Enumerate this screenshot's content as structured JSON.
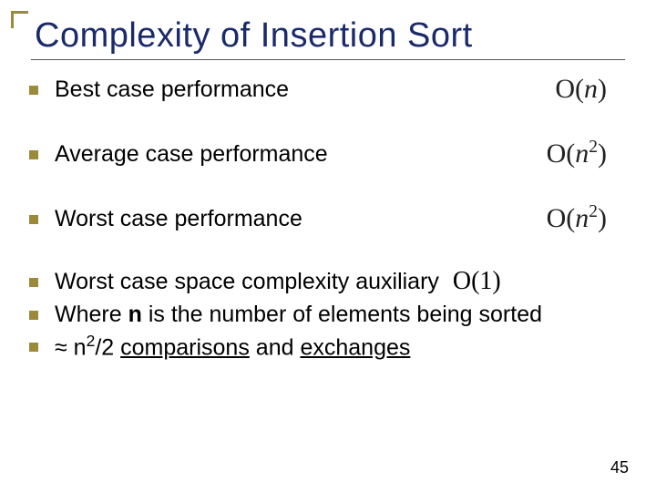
{
  "title": "Complexity of Insertion Sort",
  "bullets": {
    "best": {
      "text": "Best case performance",
      "bigO": "O(n)"
    },
    "average": {
      "text": "Average case performance",
      "bigO_base": "O(n",
      "bigO_exp": "2",
      "bigO_close": ")"
    },
    "worst": {
      "text": "Worst case performance",
      "bigO_base": "O(n",
      "bigO_exp": "2",
      "bigO_close": ")"
    },
    "space": {
      "text": "Worst case space complexity auxiliary",
      "inlineO": "O(1)"
    },
    "wheren": {
      "pre": "Where ",
      "n": "n",
      "post": " is the number of elements being sorted"
    },
    "approx": {
      "sym": "≈ ",
      "n": "n",
      "exp": "2",
      "mid": "/2 ",
      "comp": "comparisons",
      "and": " and ",
      "exch": "exchanges"
    }
  },
  "page_number": "45"
}
